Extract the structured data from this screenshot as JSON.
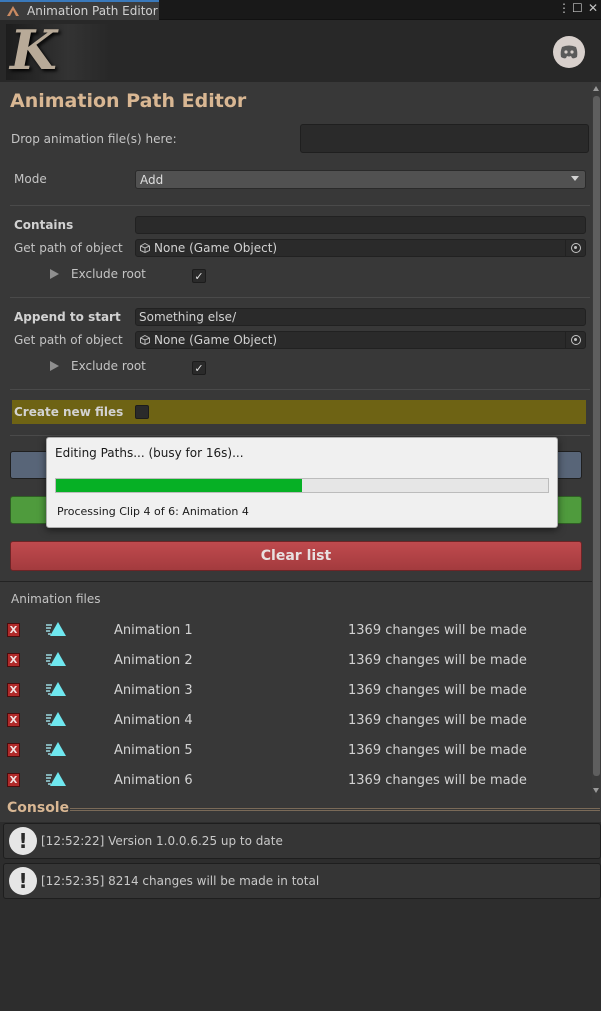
{
  "window": {
    "tab_title": "Animation Path Editor"
  },
  "header": {
    "logo_letter": "K",
    "discord_icon": "discord-icon"
  },
  "editor": {
    "title": "Animation Path Editor",
    "drop_label": "Drop animation file(s) here:",
    "mode_label": "Mode",
    "mode_value": "Add",
    "section1": {
      "contains_label": "Contains",
      "contains_value": "",
      "get_path_label": "Get path of object",
      "object_value": "None (Game Object)",
      "exclude_root_label": "Exclude root",
      "exclude_root_checked": "✓"
    },
    "section2": {
      "append_label": "Append to start",
      "append_value": "Something else/",
      "get_path_label": "Get path of object",
      "object_value": "None (Game Object)",
      "exclude_root_label": "Exclude root",
      "exclude_root_checked": "✓"
    },
    "create_new_files_label": "Create new files",
    "clear_list_label": "Clear list",
    "files_header": "Animation files",
    "remove_label": "X",
    "files": [
      {
        "name": "Animation 1",
        "changes": "1369 changes will be made"
      },
      {
        "name": "Animation 2",
        "changes": "1369 changes will be made"
      },
      {
        "name": "Animation 3",
        "changes": "1369 changes will be made"
      },
      {
        "name": "Animation 4",
        "changes": "1369 changes will be made"
      },
      {
        "name": "Animation 5",
        "changes": "1369 changes will be made"
      },
      {
        "name": "Animation 6",
        "changes": "1369 changes will be made"
      }
    ]
  },
  "console": {
    "header": "Console",
    "icon_glyph": "!",
    "entries": [
      {
        "text": "[12:52:22] Version 1.0.0.6.25 up to date"
      },
      {
        "text": "[12:52:35] 8214 changes will be made in total"
      }
    ]
  },
  "progress_dialog": {
    "title": "Editing Paths... (busy for 16s)...",
    "progress_fraction": 0.5,
    "status": "Processing Clip 4 of 6: Animation 4"
  },
  "colors": {
    "accent_title": "#d9b793",
    "create_bar": "#6e6314",
    "progress_green": "#06b025",
    "clear_red": "#b04447"
  }
}
